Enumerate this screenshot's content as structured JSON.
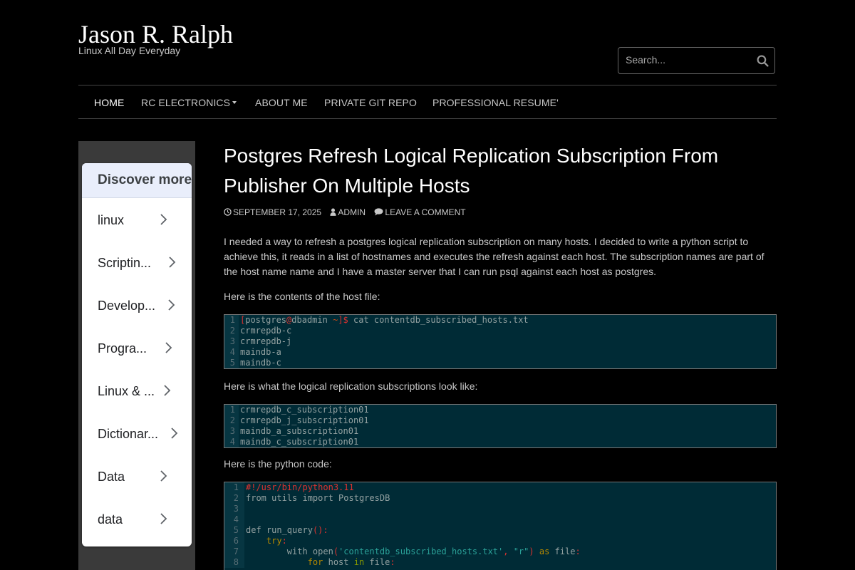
{
  "site": {
    "title": "Jason R. Ralph",
    "tagline": "Linux All Day Everyday"
  },
  "search": {
    "placeholder": "Search..."
  },
  "nav": {
    "items": [
      {
        "label": "HOME",
        "active": true
      },
      {
        "label": "RC ELECTRONICS",
        "has_dropdown": true
      },
      {
        "label": "ABOUT ME"
      },
      {
        "label": "PRIVATE GIT REPO"
      },
      {
        "label": "PROFESSIONAL RESUME'"
      }
    ]
  },
  "sidebar": {
    "discover": {
      "header": "Discover more",
      "items": [
        "linux",
        "Scriptin...",
        "Develop...",
        "Progra...",
        "Linux & ...",
        "Dictionar...",
        "Data",
        "data"
      ]
    }
  },
  "post": {
    "title": "Postgres Refresh Logical Replication Subscription From Publisher On Multiple Hosts",
    "date": "SEPTEMBER 17, 2025",
    "author": "ADMIN",
    "comment_link": "LEAVE A COMMENT",
    "intro": "I needed a way to refresh a postgres logical replication subscription on many hosts. I decided to write a python script to achieve this, it reads in a list of hostnames and executes the refresh against each host. The subscription names are part of the host name name and I have a master server that I can run psql against each host as postgres.",
    "host_file_label": "Here is the contents of the host file:",
    "subscriptions_label": "Here is what the logical replication subscriptions look like:",
    "python_label": "Here is the python code:",
    "code_host_file": {
      "prompt_user": "postgres",
      "prompt_host": "dbadmin",
      "prompt_dir": "~",
      "command": "cat contentdb_subscribed_hosts.txt",
      "lines": [
        "crmrepdb-c",
        "crmrepdb-j",
        "maindb-a",
        "maindb-c"
      ]
    },
    "code_subscriptions": {
      "lines": [
        "crmrepdb_c_subscription01",
        "crmrepdb_j_subscription01",
        "maindb_a_subscription01",
        "maindb_c_subscription01"
      ]
    },
    "code_python": {
      "shebang": "#!/usr/bin/python3.11",
      "import_line": "from utils import PostgresDB",
      "def_name": "run_query",
      "open_file": "'contentdb_subscribed_hosts.txt'",
      "open_mode": "\"r\"",
      "loop_var": "host",
      "loop_target": "file"
    },
    "line_numbers": [
      "1",
      "2",
      "3",
      "4",
      "5",
      "6",
      "7",
      "8"
    ]
  },
  "colors": {
    "background": "#000000",
    "code_bg": "#002b36",
    "code_gutter": "#073642",
    "discover_header_bg": "#e9eefb"
  }
}
